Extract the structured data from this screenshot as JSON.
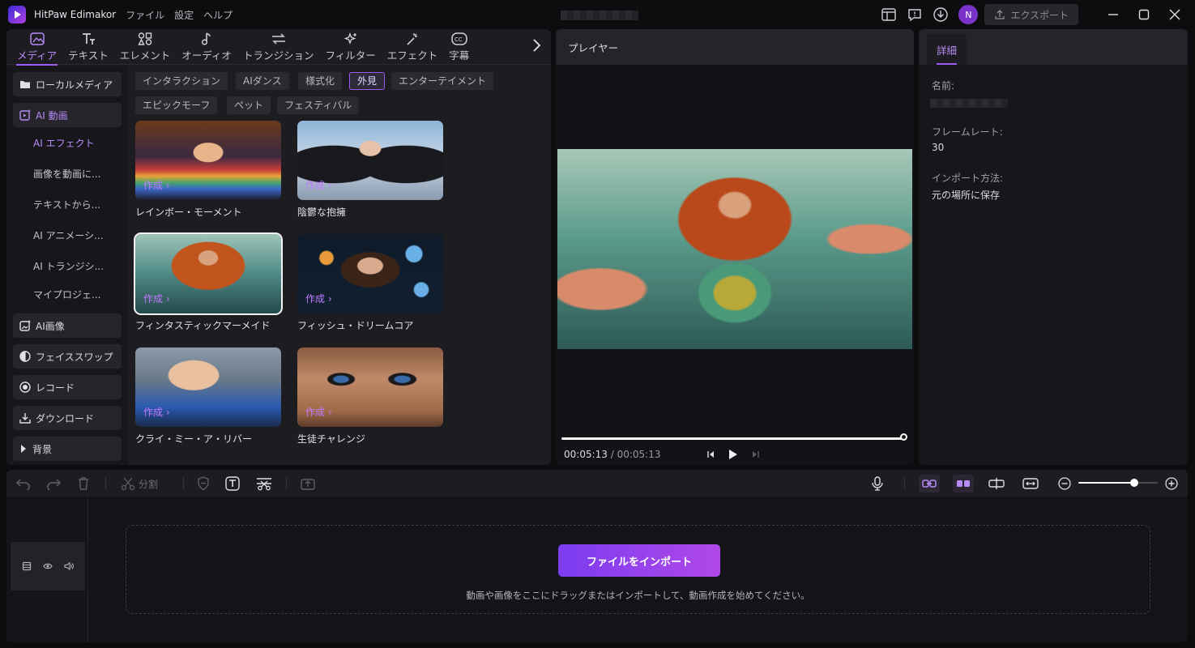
{
  "app": {
    "name": "HitPaw Edimakor",
    "menu": [
      "ファイル",
      "設定",
      "ヘルプ"
    ],
    "avatar_letter": "N",
    "export_label": "エクスポート"
  },
  "tabs": [
    {
      "label": "メディア",
      "icon": "media-icon",
      "active": true
    },
    {
      "label": "テキスト",
      "icon": "text-icon"
    },
    {
      "label": "エレメント",
      "icon": "element-icon"
    },
    {
      "label": "オーディオ",
      "icon": "audio-icon"
    },
    {
      "label": "トランジション",
      "icon": "transition-icon"
    },
    {
      "label": "フィルター",
      "icon": "filter-icon"
    },
    {
      "label": "エフェクト",
      "icon": "effect-icon"
    },
    {
      "label": "字幕",
      "icon": "subtitle-icon"
    }
  ],
  "sidebar": {
    "local_media": "ローカルメディア",
    "ai_video": "AI 動画",
    "sub": [
      "AI エフェクト",
      "画像を動画に...",
      "テキストから...",
      "AI アニメーシ...",
      "AI トランジシ...",
      "マイプロジェ..."
    ],
    "ai_image": "AI画像",
    "face_swap": "フェイススワップ",
    "record": "レコード",
    "download": "ダウンロード",
    "background": "背景"
  },
  "chips": [
    "インタラクション",
    "AIダンス",
    "様式化",
    "外見",
    "エンターテイメント",
    "エピックモーフ",
    "ペット",
    "フェスティバル"
  ],
  "active_chip": "外見",
  "cards": [
    {
      "label": "レインボー・モーメント",
      "make": "作成 ›"
    },
    {
      "label": "陰鬱な抱擁",
      "make": "作成 ›"
    },
    {
      "label": "フィンタスティックマーメイド",
      "make": "作成 ›",
      "selected": true
    },
    {
      "label": "フィッシュ・ドリームコア",
      "make": "作成 ›"
    },
    {
      "label": "クライ・ミー・ア・リバー",
      "make": "作成 ›"
    },
    {
      "label": "生徒チャレンジ",
      "make": "作成 ›"
    }
  ],
  "player": {
    "title": "プレイヤー",
    "current": "00:05:13",
    "total": "/ 00:05:13",
    "progress": 1.0
  },
  "details": {
    "tab": "詳細",
    "name_label": "名前:",
    "framerate_label": "フレームレート:",
    "framerate": "30",
    "import_label": "インポート方法:",
    "import_value": "元の場所に保存"
  },
  "toolbar": {
    "split": "分割",
    "zoom": 0.7
  },
  "timeline": {
    "import_button": "ファイルをインポート",
    "hint": "動画や画像をここにドラッグまたはインポートして、動画作成を始めてください。"
  },
  "colors": {
    "accent": "#9b5cf6",
    "accent_text": "#b78bf6",
    "bg": "#0d0d10",
    "panel": "#1c1c21"
  }
}
